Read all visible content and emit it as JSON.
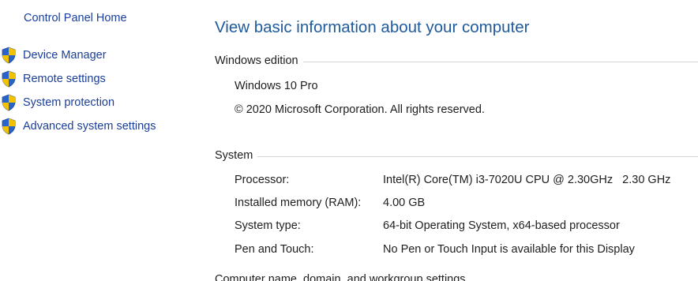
{
  "sidebar": {
    "home_link": "Control Panel Home",
    "items": [
      {
        "label": "Device Manager",
        "icon": "uac-shield-icon"
      },
      {
        "label": "Remote settings",
        "icon": "uac-shield-icon"
      },
      {
        "label": "System protection",
        "icon": "uac-shield-icon"
      },
      {
        "label": "Advanced system settings",
        "icon": "uac-shield-icon"
      }
    ]
  },
  "main": {
    "title": "View basic information about your computer",
    "windows_edition": {
      "heading": "Windows edition",
      "edition": "Windows 10 Pro",
      "copyright": "© 2020 Microsoft Corporation. All rights reserved."
    },
    "system": {
      "heading": "System",
      "rows": [
        {
          "label": "Processor:",
          "value": "Intel(R) Core(TM) i3-7020U CPU @ 2.30GHz   2.30 GHz"
        },
        {
          "label": "Installed memory (RAM):",
          "value": "4.00 GB"
        },
        {
          "label": "System type:",
          "value": "64-bit Operating System, x64-based processor"
        },
        {
          "label": "Pen and Touch:",
          "value": "No Pen or Touch Input is available for this Display"
        }
      ]
    },
    "next_section_heading": "Computer name, domain, and workgroup settings"
  },
  "colors": {
    "link": "#1a3e9a",
    "title": "#1e5a9c",
    "text": "#1e1e1e",
    "rule": "#d4d4d4",
    "shield_blue": "#2a63c9",
    "shield_yellow": "#f2c200"
  }
}
